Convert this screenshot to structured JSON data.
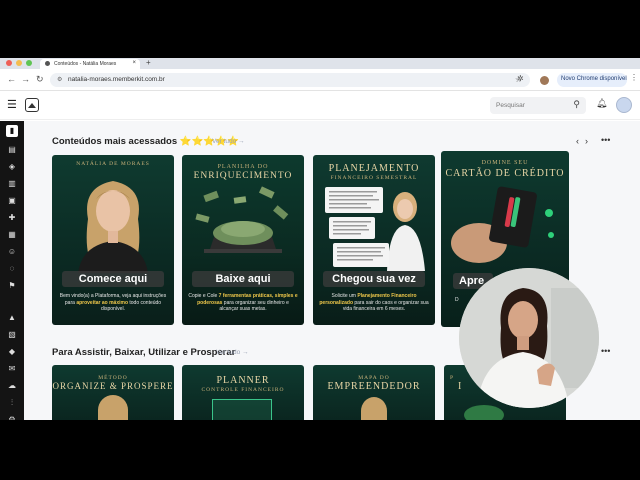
{
  "browser": {
    "tab_title": "Conteúdos - Natália Moraes",
    "url": "natalia-moraes.memberkit.com.br",
    "update_button": "Novo Chrome disponível"
  },
  "header": {
    "search_placeholder": "Pesquisar"
  },
  "section1": {
    "title": "Conteúdos mais acessados ⭐⭐⭐⭐⭐",
    "see_all": "Ver tudo →",
    "cards": [
      {
        "top": "NATÁLIA DE MORAES",
        "title": "",
        "cta": "Comece aqui",
        "desc_pre": "Bem vindo(a) a Plataforma, veja aqui instruções para ",
        "desc_hl": "aproveitar ao máximo",
        "desc_post": " todo conteúdo disponível."
      },
      {
        "top": "PLANILHA DO",
        "title": "ENRIQUECIMENTO",
        "cta": "Baixe aqui",
        "desc_pre": "Copie e Cole ",
        "desc_hl": "7 ferramentas práticas, simples e poderosas",
        "desc_post": " para organizar seu dinheiro e alcançar suas metas."
      },
      {
        "top": "PLANEJAMENTO",
        "title": "FINANCEIRO SEMESTRAL",
        "cta": "Chegou sua vez",
        "desc_pre": "Solicite um ",
        "desc_hl": "Planejamento Financeiro personalizado",
        "desc_post": " para sair do caos e organizar sua vida financeira em 6 meses."
      },
      {
        "top": "DOMINE SEU",
        "title": "CARTÃO DE CRÉDITO",
        "cta": "Apre",
        "desc_pre": "D",
        "desc_hl": "",
        "desc_post": ""
      }
    ]
  },
  "section2": {
    "title": "Para Assistir, Baixar, Utilizar e Prosperar",
    "see_all": "Ver tudo →",
    "cards": [
      {
        "top": "MÉTODO",
        "title": "ORGANIZE & PROSPERE"
      },
      {
        "top": "PLANNER",
        "title": "CONTROLE FINANCEIRO"
      },
      {
        "top": "MAPA DO",
        "title": "EMPREENDEDOR"
      },
      {
        "top": "P",
        "title": "I"
      }
    ]
  }
}
